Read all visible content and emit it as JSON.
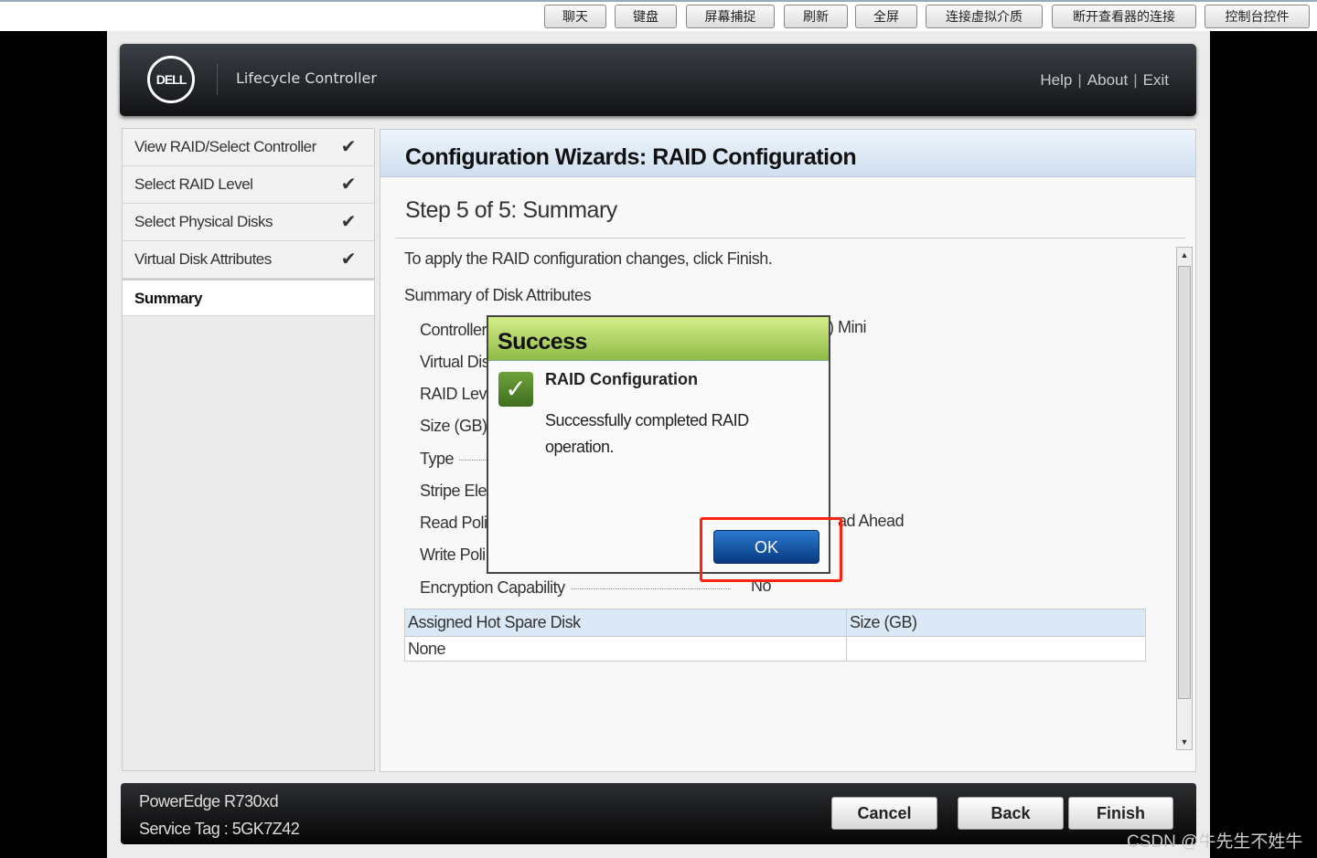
{
  "toolbar": {
    "buttons": [
      "聊天",
      "键盘",
      "屏幕捕捉",
      "刷新",
      "全屏",
      "连接虚拟介质",
      "断开查看器的连接",
      "控制台控件"
    ]
  },
  "header": {
    "logo": "DELL",
    "title": "Lifecycle Controller",
    "links": {
      "help": "Help",
      "about": "About",
      "exit": "Exit"
    },
    "sep": "|"
  },
  "sidebar": {
    "items": [
      {
        "label": "View RAID/Select Controller",
        "done": true
      },
      {
        "label": "Select RAID Level",
        "done": true
      },
      {
        "label": "Select Physical Disks",
        "done": true
      },
      {
        "label": "Virtual Disk Attributes",
        "done": true
      },
      {
        "label": "Summary",
        "done": false
      }
    ],
    "check": "✔"
  },
  "main": {
    "title": "Configuration Wizards: RAID Configuration",
    "step": "Step 5 of 5: Summary",
    "instruction": "To apply the RAID configuration changes, click Finish.",
    "summary_heading": "Summary of Disk Attributes",
    "attributes": [
      {
        "label": "Controller",
        "value": ") Mini"
      },
      {
        "label": "Virtual Dis",
        "value": ""
      },
      {
        "label": "RAID Leve",
        "value": ""
      },
      {
        "label": "Size (GB)",
        "value": ""
      },
      {
        "label": "Type",
        "value": ""
      },
      {
        "label": "Stripe Ele",
        "value": ""
      },
      {
        "label": "Read Poli",
        "value": "ad Ahead"
      },
      {
        "label": "Write Poli",
        "value": ""
      },
      {
        "label": "Encryption Capability",
        "value": "No"
      }
    ],
    "hot_spare": {
      "headers": [
        "Assigned Hot Spare Disk",
        "Size (GB)"
      ],
      "rows": [
        [
          "None",
          ""
        ]
      ]
    }
  },
  "dialog": {
    "title": "Success",
    "heading": "RAID Configuration",
    "message": "Successfully completed RAID operation.",
    "ok": "OK",
    "header_color": "#9cc653",
    "highlight_color": "#ff2211"
  },
  "footer": {
    "model": "PowerEdge R730xd",
    "service_tag": "Service Tag : 5GK7Z42",
    "cancel": "Cancel",
    "back": "Back",
    "finish": "Finish"
  },
  "watermark": "CSDN @牛先生不姓牛"
}
